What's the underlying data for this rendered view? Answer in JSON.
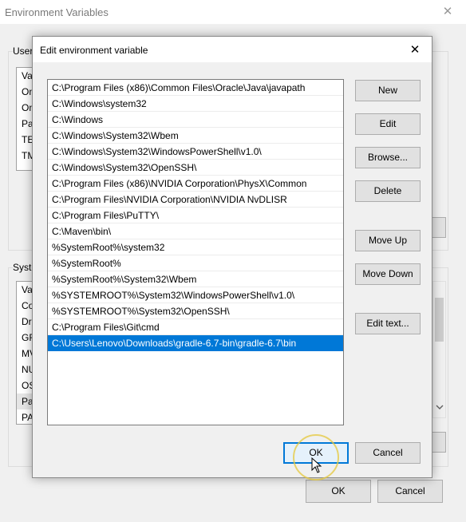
{
  "bg_window": {
    "title": "Environment Variables",
    "close_glyph": "✕",
    "user_group_label": "User",
    "user_rows": [
      "Va",
      "On",
      "On",
      "Pa",
      "TE",
      "TM"
    ],
    "system_group_label": "Syste",
    "system_rows": [
      "Va",
      "Co",
      "Dr",
      "GR",
      "MV",
      "NU",
      "OS",
      "Pa",
      "PA"
    ],
    "ok_label": "OK",
    "cancel_label": "Cancel"
  },
  "dialog": {
    "title": "Edit environment variable",
    "close_glyph": "✕",
    "paths": [
      "C:\\Program Files (x86)\\Common Files\\Oracle\\Java\\javapath",
      "C:\\Windows\\system32",
      "C:\\Windows",
      "C:\\Windows\\System32\\Wbem",
      "C:\\Windows\\System32\\WindowsPowerShell\\v1.0\\",
      "C:\\Windows\\System32\\OpenSSH\\",
      "C:\\Program Files (x86)\\NVIDIA Corporation\\PhysX\\Common",
      "C:\\Program Files\\NVIDIA Corporation\\NVIDIA NvDLISR",
      "C:\\Program Files\\PuTTY\\",
      "C:\\Maven\\bin\\",
      "%SystemRoot%\\system32",
      "%SystemRoot%",
      "%SystemRoot%\\System32\\Wbem",
      "%SYSTEMROOT%\\System32\\WindowsPowerShell\\v1.0\\",
      "%SYSTEMROOT%\\System32\\OpenSSH\\",
      "C:\\Program Files\\Git\\cmd",
      "C:\\Users\\Lenovo\\Downloads\\gradle-6.7-bin\\gradle-6.7\\bin"
    ],
    "buttons": {
      "new": "New",
      "edit": "Edit",
      "browse": "Browse...",
      "delete": "Delete",
      "move_up": "Move Up",
      "move_down": "Move Down",
      "edit_text": "Edit text...",
      "ok": "OK",
      "cancel": "Cancel"
    }
  },
  "colors": {
    "selection": "#0078d7",
    "cursor_highlight": "#e6c83c"
  },
  "icons": {
    "close": "close-icon",
    "cursor": "mouse-pointer-icon"
  }
}
